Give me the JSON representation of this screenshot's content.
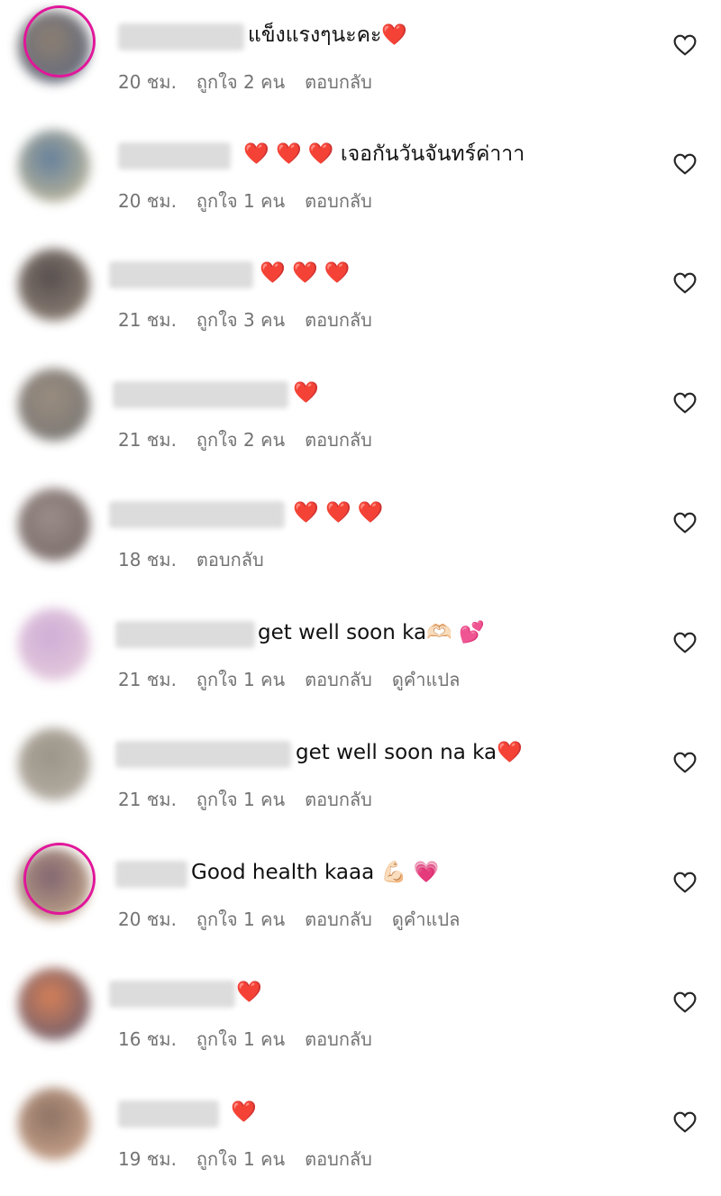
{
  "comments": [
    {
      "text": "แข็งแรงๆนะคะ❤️",
      "time": "20 ชม.",
      "likes": "ถูกใจ 2 คน",
      "reply": "ตอบกลับ",
      "translate": "",
      "story_ring": true
    },
    {
      "text": "❤️ ❤️ ❤️ เจอกันวันจันทร์ค่าาา",
      "time": "20 ชม.",
      "likes": "ถูกใจ 1 คน",
      "reply": "ตอบกลับ",
      "translate": "",
      "story_ring": false
    },
    {
      "text": "❤️ ❤️ ❤️",
      "time": "21 ชม.",
      "likes": "ถูกใจ 3 คน",
      "reply": "ตอบกลับ",
      "translate": "",
      "story_ring": false
    },
    {
      "text": "❤️",
      "time": "21 ชม.",
      "likes": "ถูกใจ 2 คน",
      "reply": "ตอบกลับ",
      "translate": "",
      "story_ring": false
    },
    {
      "text": "❤️ ❤️ ❤️",
      "time": "18 ชม.",
      "likes": "",
      "reply": "ตอบกลับ",
      "translate": "",
      "story_ring": false
    },
    {
      "text": "get well soon ka🫶🏻 💕",
      "time": "21 ชม.",
      "likes": "ถูกใจ 1 คน",
      "reply": "ตอบกลับ",
      "translate": "ดูคำแปล",
      "story_ring": false
    },
    {
      "text": "get well soon na ka❤️",
      "time": "21 ชม.",
      "likes": "ถูกใจ 1 คน",
      "reply": "ตอบกลับ",
      "translate": "",
      "story_ring": false
    },
    {
      "text": "Good health kaaa 💪🏻 💗",
      "time": "20 ชม.",
      "likes": "ถูกใจ 1 คน",
      "reply": "ตอบกลับ",
      "translate": "ดูคำแปล",
      "story_ring": true
    },
    {
      "text": "❤️",
      "time": "16 ชม.",
      "likes": "ถูกใจ 1 คน",
      "reply": "ตอบกลับ",
      "translate": "",
      "story_ring": false
    },
    {
      "text": "❤️",
      "time": "19 ชม.",
      "likes": "ถูกใจ 1 คน",
      "reply": "ตอบกลับ",
      "translate": "",
      "story_ring": false
    }
  ],
  "icons": {
    "like": "heart-outline-icon"
  },
  "colors": {
    "meta": "#737373",
    "story_ring": "#e1179a",
    "heart": "#262626"
  }
}
